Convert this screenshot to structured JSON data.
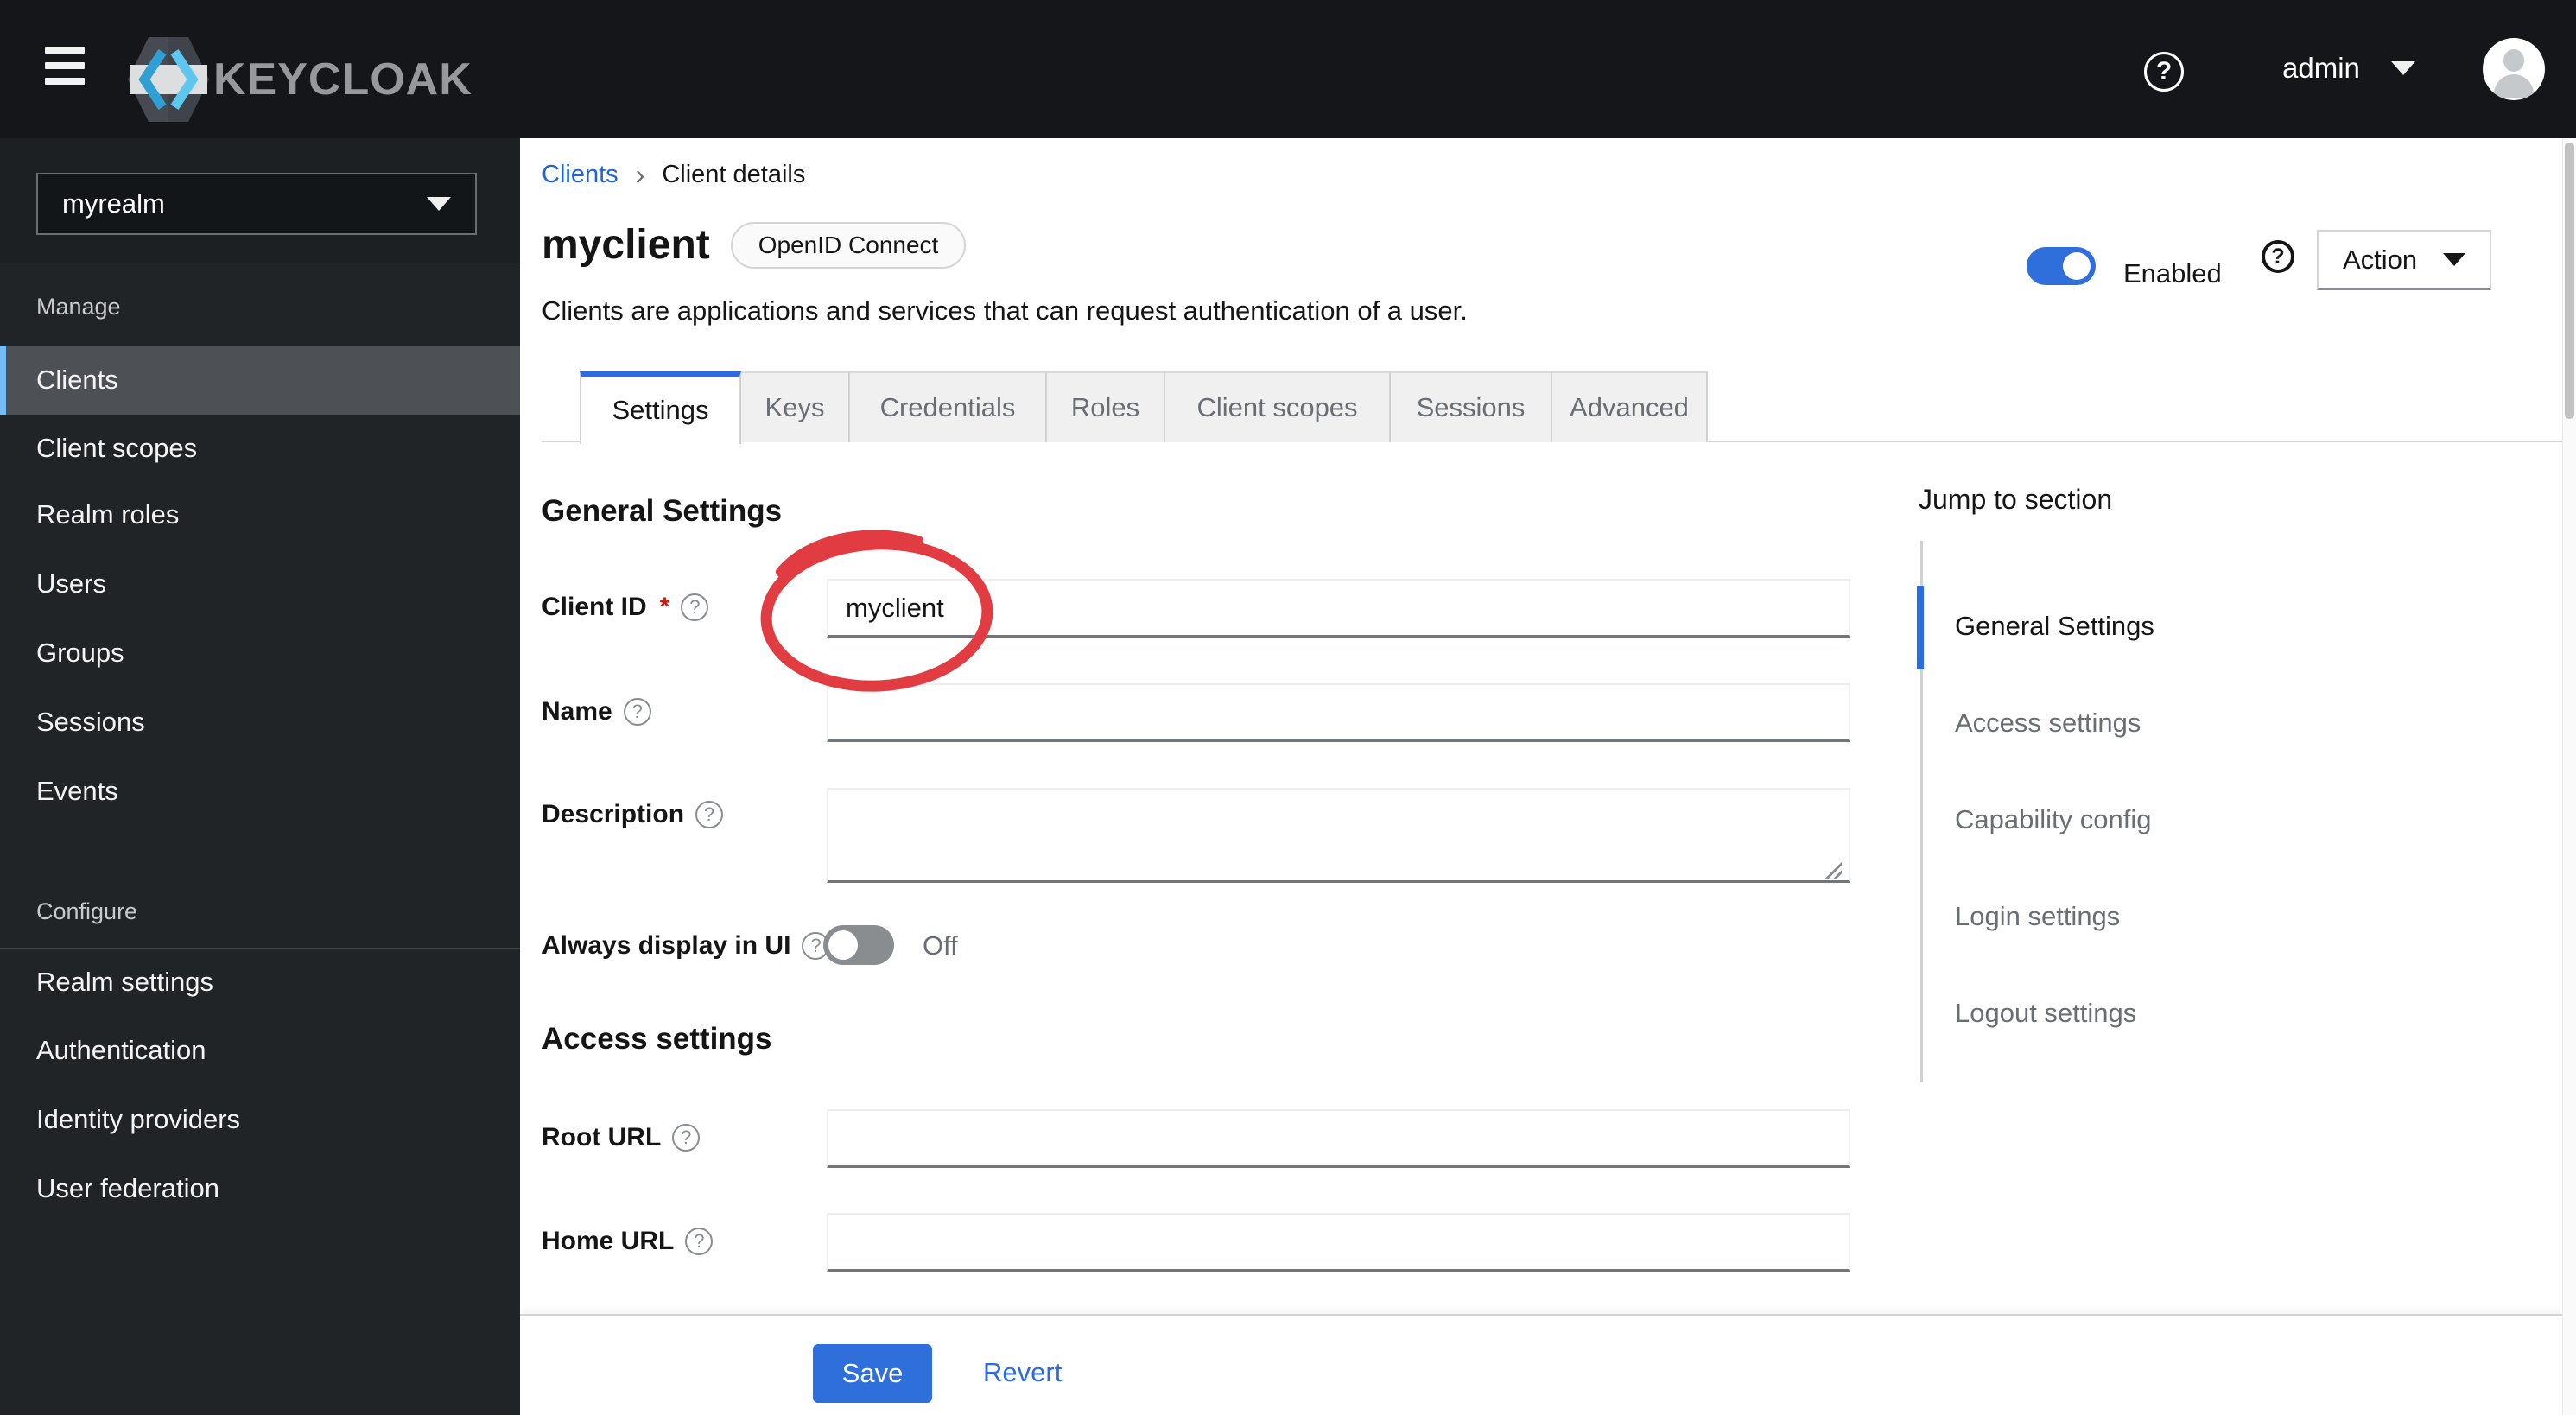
{
  "masthead": {
    "brand": "KEYCLOAK",
    "user": "admin"
  },
  "sidebar": {
    "realm": "myrealm",
    "sections": [
      {
        "label": "Manage",
        "items": [
          "Clients",
          "Client scopes",
          "Realm roles",
          "Users",
          "Groups",
          "Sessions",
          "Events"
        ]
      },
      {
        "label": "Configure",
        "items": [
          "Realm settings",
          "Authentication",
          "Identity providers",
          "User federation"
        ]
      }
    ]
  },
  "breadcrumb": {
    "link": "Clients",
    "current": "Client details"
  },
  "header": {
    "title": "myclient",
    "badge": "OpenID Connect",
    "description": "Clients are applications and services that can request authentication of a user.",
    "enabled_label": "Enabled",
    "action_label": "Action"
  },
  "tabs": {
    "items": [
      "Settings",
      "Keys",
      "Credentials",
      "Roles",
      "Client scopes",
      "Sessions",
      "Advanced"
    ]
  },
  "form": {
    "general_heading": "General Settings",
    "fields": {
      "client_id": {
        "label": "Client ID",
        "required": "*",
        "value": "myclient"
      },
      "name": {
        "label": "Name",
        "value": ""
      },
      "description": {
        "label": "Description",
        "value": ""
      },
      "always_display": {
        "label": "Always display in UI",
        "value": "Off"
      }
    },
    "access_heading": "Access settings",
    "access_fields": {
      "root_url": {
        "label": "Root URL",
        "value": ""
      },
      "home_url": {
        "label": "Home URL",
        "value": ""
      }
    }
  },
  "jump_to": {
    "title": "Jump to section",
    "items": [
      "General Settings",
      "Access settings",
      "Capability config",
      "Login settings",
      "Logout settings"
    ]
  },
  "footer": {
    "save": "Save",
    "revert": "Revert"
  },
  "colors": {
    "primary": "#2e6fdb",
    "tab_accent": "#2b6cde",
    "nav_accent": "#73bcf7",
    "link": "#2064d4",
    "annotation": "#e23c43"
  }
}
